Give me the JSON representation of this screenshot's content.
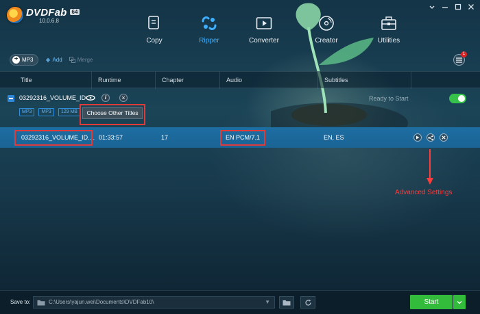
{
  "app": {
    "name": "DVDFab",
    "version_badge": "64",
    "build": "10.0.6.8"
  },
  "nav": {
    "items": [
      {
        "label": "Copy",
        "icon": "copy-icon"
      },
      {
        "label": "Ripper",
        "icon": "ripper-icon",
        "active": true
      },
      {
        "label": "Converter",
        "icon": "converter-icon"
      },
      {
        "label": "Creator",
        "icon": "creator-icon"
      },
      {
        "label": "Utilities",
        "icon": "utilities-icon"
      }
    ]
  },
  "toolbar": {
    "profile_label": "MP3",
    "add_label": "Add",
    "merge_label": "Merge",
    "queue_badge": "1"
  },
  "table": {
    "headers": [
      "Title",
      "Runtime",
      "Chapter",
      "Audio",
      "Subtitles"
    ],
    "source": {
      "name": "03292316_VOLUME_ID",
      "status": "Ready to Start",
      "tags": [
        "MP3",
        "MP3",
        "129 MB"
      ],
      "choose_label": "Choose Other Titles"
    },
    "row": {
      "title": "03292316_VOLUME_ID....",
      "runtime": "01:33:57",
      "chapter": "17",
      "audio": "EN  PCM/7.1",
      "subtitles": "EN, ES"
    }
  },
  "annotation": {
    "label": "Advanced Settings",
    "color": "#ff3b3b"
  },
  "bottom": {
    "save_to_label": "Save to:",
    "path": "C:\\Users\\yajun.wei\\Documents\\DVDFab10\\",
    "start_label": "Start"
  },
  "colors": {
    "accent_blue": "#3fb0ff",
    "selected_row": "#1e6ea2",
    "start_green": "#33bb3c",
    "highlight_red": "#e03a3a"
  }
}
